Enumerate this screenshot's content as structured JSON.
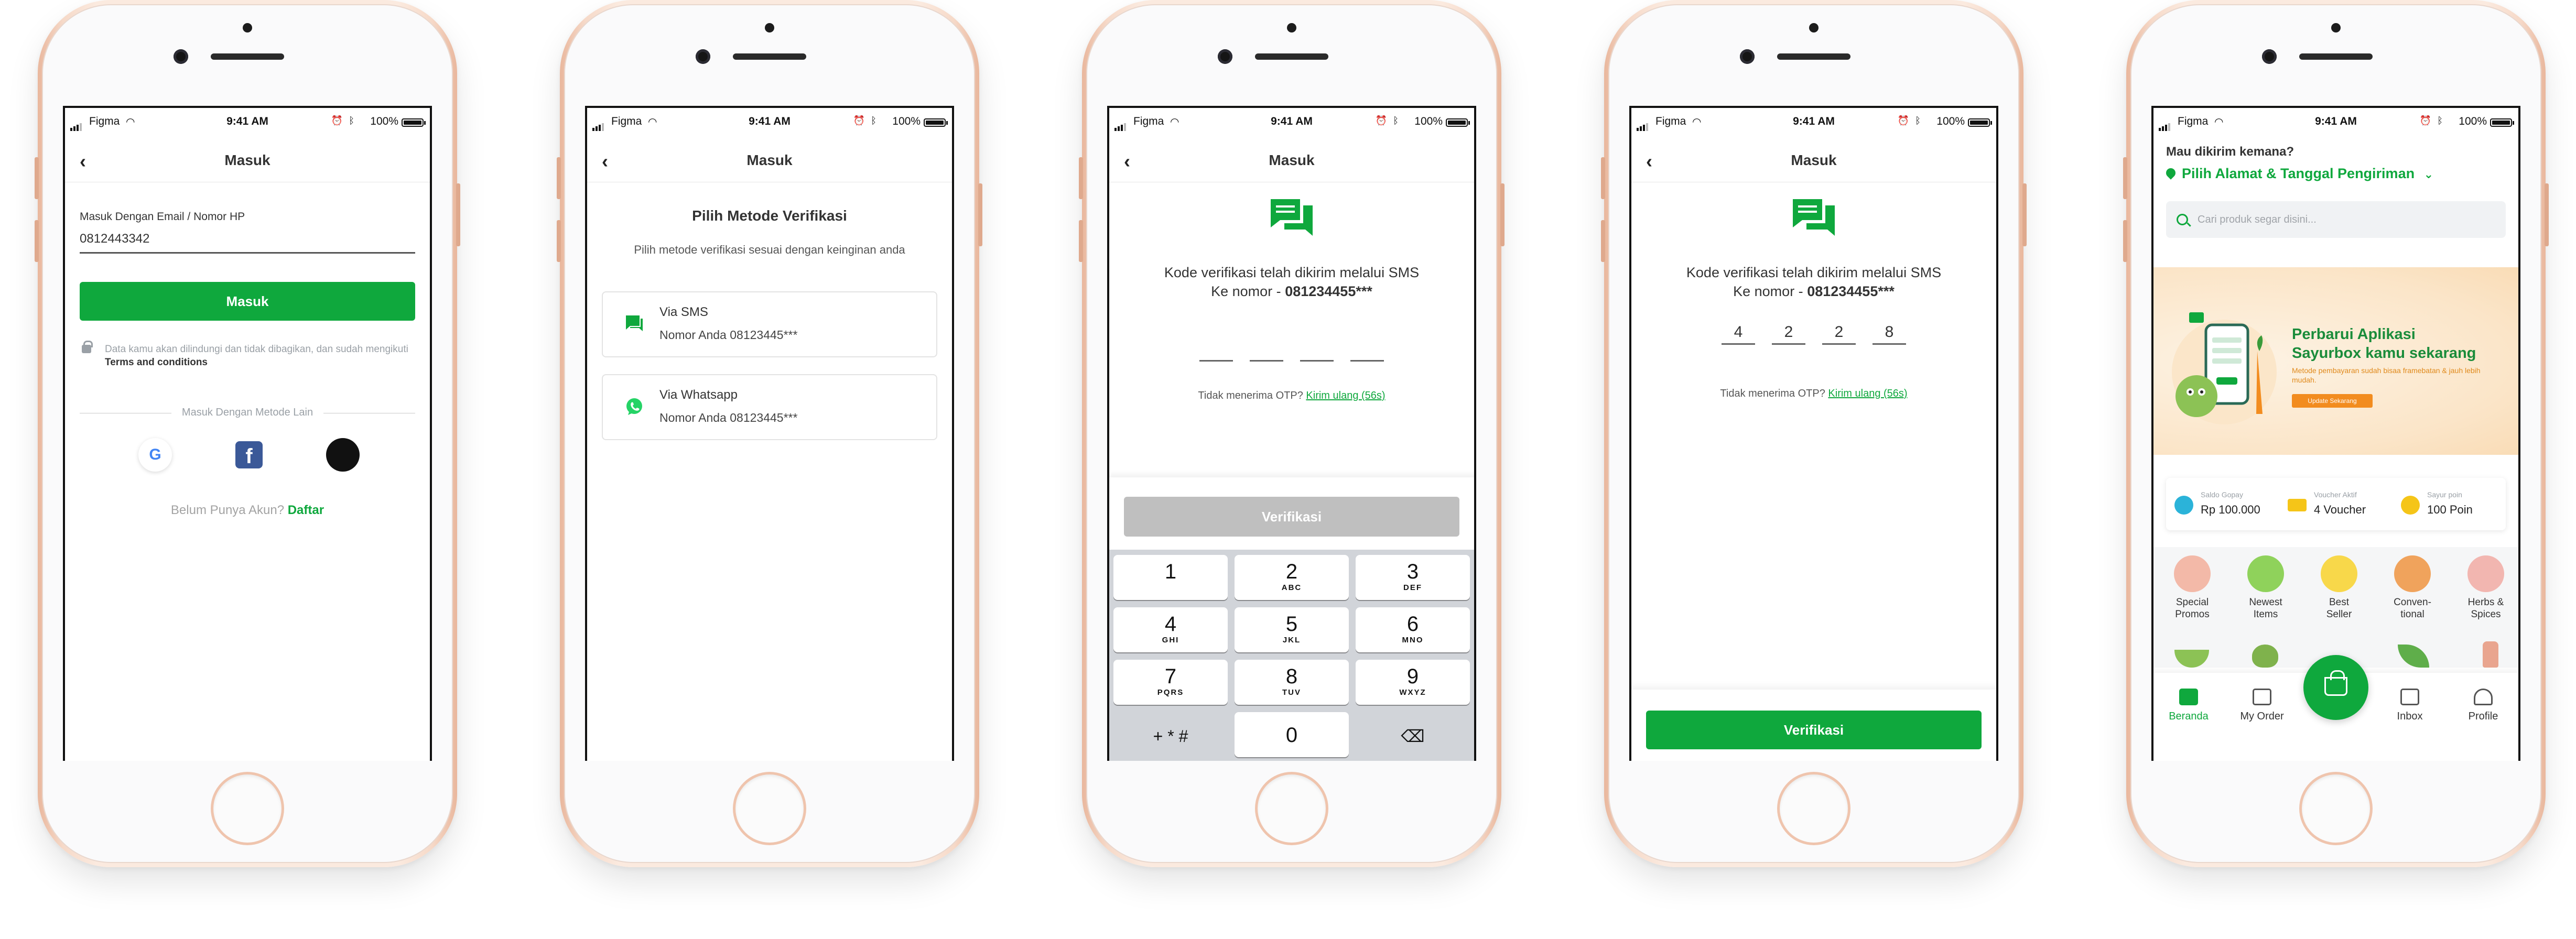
{
  "status_bar": {
    "carrier": "Figma",
    "time": "9:41 AM",
    "battery": "100%"
  },
  "screen1": {
    "title": "Masuk",
    "field_label": "Masuk Dengan Email / Nomor HP",
    "field_value": "0812443342",
    "login_button": "Masuk",
    "note_text": "Data kamu akan dilindungi dan tidak dibagikan, dan sudah mengikuti ",
    "note_link": "Terms and conditions",
    "divider": "Masuk Dengan Metode Lain",
    "signup_prompt": "Belum Punya Akun? ",
    "signup_link": "Daftar"
  },
  "screen2": {
    "title": "Masuk",
    "heading": "Pilih Metode Verifikasi",
    "subheading": "Pilih metode verifikasi sesuai dengan keinginan anda",
    "options": [
      {
        "label": "Via SMS",
        "detail": "Nomor Anda 08123445***"
      },
      {
        "label": "Via Whatsapp",
        "detail": "Nomor Anda 08123445***"
      }
    ]
  },
  "screen3": {
    "title": "Masuk",
    "message_line1": "Kode verifikasi telah dikirim melalui SMS",
    "message_line2_prefix": "Ke nomor - ",
    "phone_masked": "081234455***",
    "resend_prompt": "Tidak menerima OTP? ",
    "resend_link": "Kirim ulang (56s)",
    "verify_button": "Verifikasi",
    "keypad": [
      {
        "digit": "1",
        "letters": ""
      },
      {
        "digit": "2",
        "letters": "ABC"
      },
      {
        "digit": "3",
        "letters": "DEF"
      },
      {
        "digit": "4",
        "letters": "GHI"
      },
      {
        "digit": "5",
        "letters": "JKL"
      },
      {
        "digit": "6",
        "letters": "MNO"
      },
      {
        "digit": "7",
        "letters": "PQRS"
      },
      {
        "digit": "8",
        "letters": "TUV"
      },
      {
        "digit": "9",
        "letters": "WXYZ"
      },
      {
        "digit": "+ * #",
        "letters": ""
      },
      {
        "digit": "0",
        "letters": ""
      },
      {
        "digit": "⌫",
        "letters": ""
      }
    ]
  },
  "screen4": {
    "title": "Masuk",
    "message_line1": "Kode verifikasi telah dikirim melalui SMS",
    "message_line2_prefix": "Ke nomor - ",
    "phone_masked": "081234455***",
    "otp_digits": [
      "4",
      "2",
      "2",
      "8"
    ],
    "resend_prompt": "Tidak menerima OTP? ",
    "resend_link": "Kirim ulang (56s)",
    "verify_button": "Verifikasi"
  },
  "screen5": {
    "question": "Mau dikirim kemana?",
    "address_picker": "Pilih Alamat & Tanggal Pengiriman",
    "search_placeholder": "Cari produk segar disini...",
    "banner": {
      "headline_line1": "Perbarui Aplikasi",
      "headline_line2": "Sayurbox kamu sekarang",
      "body": "Metode pembayaran sudah bisaa framebatan & jauh lebih mudah.",
      "cta": "Update Sekarang"
    },
    "stats": [
      {
        "label": "Saldo Gopay",
        "value": "Rp 100.000",
        "color": "#2bb3d9"
      },
      {
        "label": "Voucher Aktif",
        "value": "4 Voucher",
        "color": "#f5c518"
      },
      {
        "label": "Sayur poin",
        "value": "100 Poin",
        "color": "#f5c518"
      }
    ],
    "categories": [
      {
        "line1": "Special",
        "line2": "Promos",
        "color": "#f3b9a8"
      },
      {
        "line1": "Newest",
        "line2": "Items",
        "color": "#8fd25b"
      },
      {
        "line1": "Best",
        "line2": "Seller",
        "color": "#f8d84a"
      },
      {
        "line1": "Conven-",
        "line2": "tional",
        "color": "#f0a35c"
      },
      {
        "line1": "Herbs &",
        "line2": "Spices",
        "color": "#f2b6b0"
      }
    ],
    "nav": [
      {
        "label": "Beranda",
        "active": true
      },
      {
        "label": "My Order",
        "active": false
      },
      {
        "label": "Inbox",
        "active": false
      },
      {
        "label": "Profile",
        "active": false
      }
    ]
  },
  "colors": {
    "brand_green": "#0fa83d",
    "disabled_gray": "#bfbfbf",
    "phone_gold": "#f6d9c8"
  }
}
